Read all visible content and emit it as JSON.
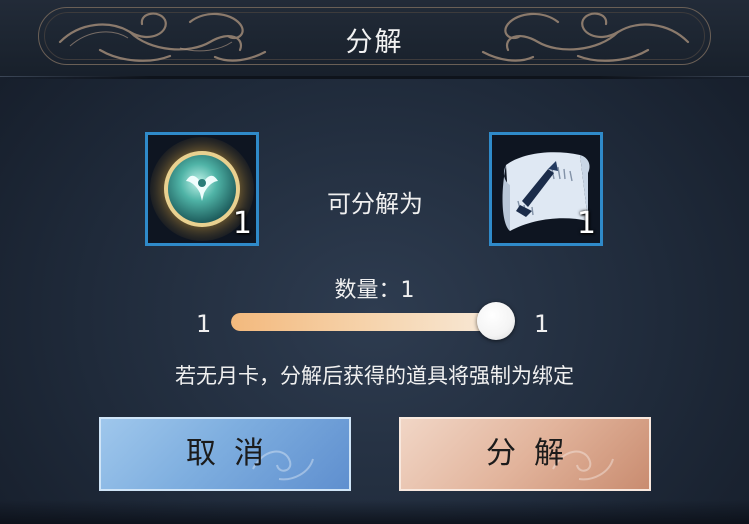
{
  "dialog": {
    "title": "分解"
  },
  "source_item": {
    "icon": "jade-orb-icon",
    "count": "1"
  },
  "result_item": {
    "icon": "skill-scroll-icon",
    "count": "1"
  },
  "arrow_label": "可分解为",
  "quantity": {
    "label": "数量：",
    "value": "1",
    "min": "1",
    "max": "1",
    "fill_fraction": 1.0
  },
  "notice": "若无月卡，分解后获得的道具将强制为绑定",
  "buttons": {
    "cancel": "取消",
    "confirm": "分解"
  },
  "colors": {
    "slot_border": "#2f8ac9",
    "cancel_button": "#7eaedf",
    "confirm_button": "#e2b49c",
    "slider_fill": "#f3b97d"
  }
}
